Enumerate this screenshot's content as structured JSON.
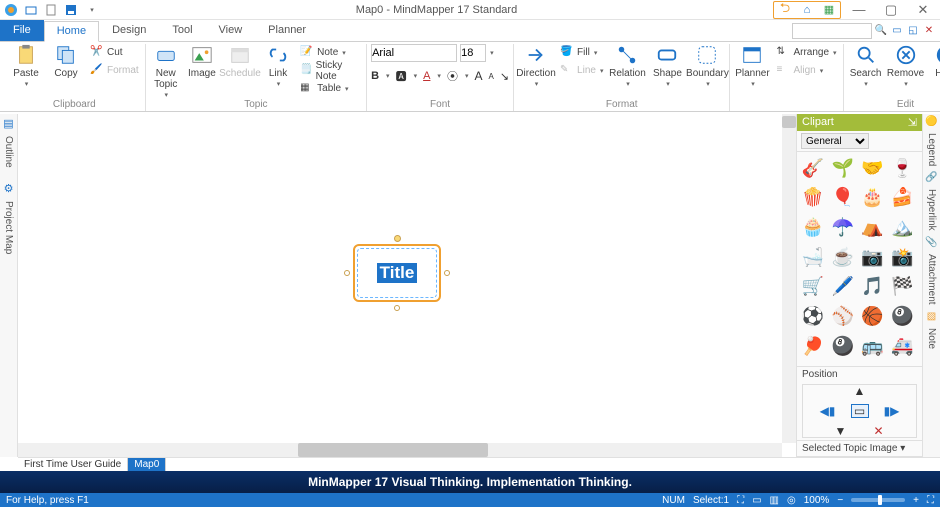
{
  "title": "Map0 - MindMapper 17 Standard",
  "tabs": {
    "file": "File",
    "home": "Home",
    "design": "Design",
    "tool": "Tool",
    "view": "View",
    "planner": "Planner"
  },
  "ribbon": {
    "clipboard": {
      "paste": "Paste",
      "copy": "Copy",
      "cut": "Cut",
      "format": "Format",
      "label": "Clipboard"
    },
    "topic": {
      "new": "New\nTopic",
      "image": "Image",
      "schedule": "Schedule",
      "link": "Link",
      "note": "Note",
      "sticky": "Sticky Note",
      "table": "Table",
      "label": "Topic"
    },
    "font": {
      "name": "Arial",
      "size": "18",
      "label": "Font"
    },
    "format": {
      "direction": "Direction",
      "relation": "Relation",
      "shape": "Shape",
      "boundary": "Boundary",
      "fill": "Fill",
      "line": "Line",
      "label": "Format"
    },
    "plan": {
      "planner": "Planner",
      "arrange": "Arrange",
      "align": "Align"
    },
    "edit": {
      "search": "Search",
      "remove": "Remove",
      "help": "Help",
      "label": "Edit"
    }
  },
  "left": {
    "outline": "Outline",
    "project": "Project Map"
  },
  "topic_text": "Title",
  "clipart": {
    "title": "Clipart",
    "pin": "📌",
    "category": "General",
    "icons": [
      "🎸",
      "🌱",
      "🤝",
      "🍷",
      "🍿",
      "🎈",
      "🎂",
      "🍰",
      "🧁",
      "☂️",
      "⛺",
      "🏔️",
      "🛁",
      "☕",
      "📷",
      "📸",
      "🛒",
      "🖊️",
      "🎵",
      "🏁",
      "⚽",
      "⚾",
      "🏀",
      "🎱",
      "🏓",
      "🎱",
      "🚌",
      "🚑"
    ],
    "position": "Position",
    "sel_topic": "Selected Topic Image",
    "image": "Image"
  },
  "sidetabs": {
    "legend": "Legend",
    "hyperlink": "Hyperlink",
    "attachment": "Attachment",
    "note": "Note"
  },
  "doctabs": {
    "guide": "First Time User Guide",
    "map": "Map0"
  },
  "banner": "MinMapper 17 Visual Thinking. Implementation Thinking.",
  "status": {
    "help": "For Help, press F1",
    "num": "NUM",
    "select": "Select:1",
    "zoom": "100%"
  }
}
